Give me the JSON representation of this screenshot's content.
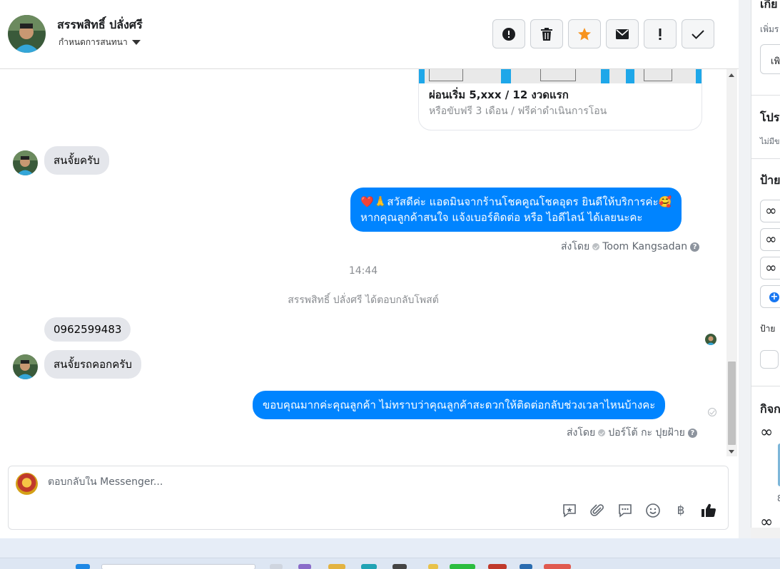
{
  "header": {
    "contact_name": "สรรพสิทธิ์ ปลั่งศรี",
    "assign_label": "กำหนดการสนทนา",
    "toolbar_icons": [
      "alert-circle-icon",
      "trash-icon",
      "star-icon",
      "envelope-icon",
      "exclamation-icon",
      "check-icon"
    ]
  },
  "card": {
    "title": "ผ่อนเริ่ม 5,xxx / 12 งวดแรก",
    "subtitle": "หรือขับฟรี 3 เดือน / ฟรีค่าดำเนินการโอน"
  },
  "messages": {
    "in_1": "สนจั้ยครับ",
    "out_1_line1": "❤️🙏สวัสดีค่ะ แอดมินจากร้านโชคคูณโชคอุดร ยินดีให้บริการค่ะ🥰",
    "out_1_line2": "หากคุณลูกค้าสนใจ แจ้งเบอร์ติดต่อ หรือ ไอดีไลน์ ได้เลยนะคะ",
    "sent_by_1_prefix": "ส่งโดย",
    "sent_by_1_name": "Toom Kangsadan",
    "time": "14:44",
    "reply_notice": "สรรพสิทธิ์ ปลั่งศรี ได้ตอบกลับโพสต์",
    "in_2": "0962599483",
    "in_3": "สนจั้ยรถคอกครับ",
    "out_2": "ขอบคุณมากค่ะคุณลูกค้า ไม่ทราบว่าคุณลูกค้าสะดวกให้ติดต่อกลับช่วงเวลาไหนบ้างคะ",
    "sent_by_2_prefix": "ส่งโดย",
    "sent_by_2_name": "ปอร์โต้ กะ ปุยฝ้าย"
  },
  "composer": {
    "placeholder": "ตอบกลับใน Messenger...",
    "icons": [
      "saved-reply-icon",
      "attachment-icon",
      "chat-bubble-icon",
      "emoji-icon",
      "baht-icon",
      "like-icon"
    ],
    "baht_symbol": "฿"
  },
  "sidebar": {
    "t1": "เกีย",
    "t2": "เพิ่มร",
    "t3": "เพิ",
    "t4": "โปร",
    "t5": "ไม่มีข",
    "t6": "ป้าย",
    "t7": "ป้าย",
    "t8": "กิจก",
    "t9": "8"
  },
  "colors": {
    "outgoing_bubble": "#0084ff",
    "incoming_bubble": "#e4e6eb",
    "star": "#f7931e"
  }
}
